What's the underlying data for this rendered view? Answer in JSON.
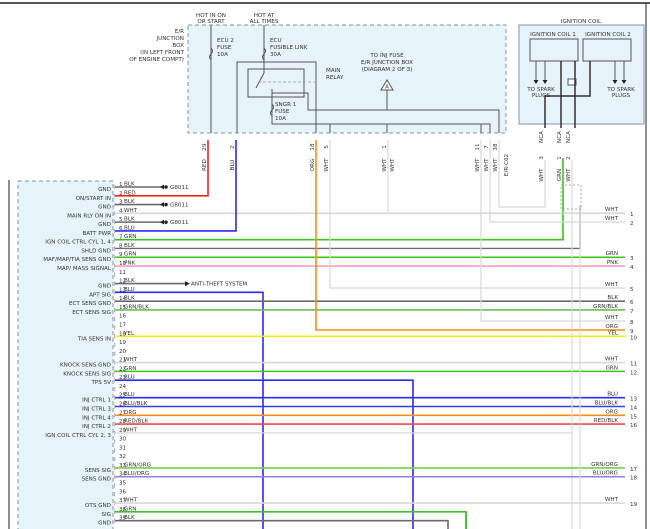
{
  "wire_colors": {
    "RED": "#ff2020",
    "BLU": "#2a2aff",
    "GRN": "#3cc21c",
    "BLK": "#6a6a6a",
    "WHT": "#d8d8d8",
    "PNK": "#f5a0b4",
    "YEL": "#f2f000",
    "ORG": "#ff8a10",
    "GRN/BLK": "#6cc050",
    "BLU/BLK": "#3a3ae8",
    "RED/BLK": "#f04848",
    "GRN/ORG": "#80c848",
    "BLU/ORG": "#9080e4"
  },
  "panel_fill": "#e6f3fa",
  "junction_box": {
    "label": [
      "E/R",
      "JUNCTION",
      "BOX",
      "(IN LEFT FRONT",
      "OF ENGINE COMPT)"
    ],
    "hot_in_on_start": [
      "HOT IN ON",
      "OR START"
    ],
    "hot_at_all_times": [
      "HOT AT",
      "ALL TIMES"
    ],
    "ecu2_fuse": [
      "ECU 2",
      "FUSE",
      "10A"
    ],
    "ecu_fusible_link": [
      "ECU",
      "FUSIBLE LINK",
      "30A"
    ],
    "main_relay": [
      "MAIN",
      "RELAY"
    ],
    "sngr1_fuse": [
      "SNGR 1",
      "FUSE",
      "10A"
    ],
    "to_inj_fuse": [
      "TO INJ FUSE",
      "E/R JUNCTION BOX",
      "(DIAGRAM 2 OF 3)"
    ],
    "ref_marker": "A",
    "connector_id": "E/R-C62",
    "pins": [
      {
        "pin": "29",
        "color": "RED"
      },
      {
        "pin": "2",
        "color": "BLU"
      },
      {
        "pin": "18",
        "color": "ORG"
      },
      {
        "pin": "5",
        "color": "WHT"
      },
      {
        "pin": "1",
        "color": "WHT",
        "color2": "WHT"
      },
      {
        "pin": "11",
        "color": "WHT"
      },
      {
        "pin": "7",
        "color": "WHT"
      },
      {
        "pin": "38",
        "color": "WHT"
      }
    ]
  },
  "ignition_coil": {
    "title": "IGNITION COIL",
    "coil1": "IGNITION COIL 1",
    "coil2": "IGNITION COIL 2",
    "to_spark_plugs": [
      "TO SPARK",
      "PLUGS"
    ],
    "connector_id": "NCA",
    "pins": [
      {
        "pin": "3",
        "color": "WHT"
      },
      {
        "pin": "1",
        "color": "GRN"
      },
      {
        "pin": "2",
        "color": "WHT"
      }
    ]
  },
  "ground_label": "G8011",
  "anti_theft_label": "ANTI-THEFT SYSTEM",
  "ecm_pins": [
    {
      "pin": "1",
      "label": "GND",
      "color": "BLK"
    },
    {
      "pin": "2",
      "label": "ON/START IN",
      "color": "RED"
    },
    {
      "pin": "3",
      "label": "GND",
      "color": "BLK"
    },
    {
      "pin": "4",
      "label": "MAIN RLY ON IN",
      "color": "WHT"
    },
    {
      "pin": "5",
      "label": "GND",
      "color": "BLK"
    },
    {
      "pin": "6",
      "label": "BATT PWR",
      "color": "BLU"
    },
    {
      "pin": "7",
      "label": "IGN COIL CTRL CYL 1, 4",
      "color": "GRN"
    },
    {
      "pin": "8",
      "label": "SHLD GND",
      "color": "BLK"
    },
    {
      "pin": "9",
      "label": "MAF/MAP/TIA SENS GND",
      "color": "GRN"
    },
    {
      "pin": "10",
      "label": "MAP/ MASS SIGNAL",
      "color": "PNK"
    },
    {
      "pin": "11",
      "label": "",
      "color": ""
    },
    {
      "pin": "12",
      "label": "GND",
      "color": "BLK"
    },
    {
      "pin": "13",
      "label": "APT SIG",
      "color": "BLU"
    },
    {
      "pin": "14",
      "label": "ECT SENS GND",
      "color": "BLK"
    },
    {
      "pin": "15",
      "label": "ECT SENS SIG",
      "color": "GRN/BLK"
    },
    {
      "pin": "16",
      "label": "",
      "color": ""
    },
    {
      "pin": "17",
      "label": "",
      "color": ""
    },
    {
      "pin": "18",
      "label": "TIA SENS IN",
      "color": "YEL"
    },
    {
      "pin": "19",
      "label": "",
      "color": ""
    },
    {
      "pin": "20",
      "label": "",
      "color": ""
    },
    {
      "pin": "21",
      "label": "KNOCK SENS GND",
      "color": "WHT"
    },
    {
      "pin": "22",
      "label": "KNOCK SENS SIG",
      "color": "GRN"
    },
    {
      "pin": "23",
      "label": "TPS 5V",
      "color": "BLU"
    },
    {
      "pin": "24",
      "label": "",
      "color": ""
    },
    {
      "pin": "25",
      "label": "INJ CTRL 1",
      "color": "BLU"
    },
    {
      "pin": "26",
      "label": "INJ CTRL 3",
      "color": "BLU/BLK"
    },
    {
      "pin": "27",
      "label": "INJ CTRL 4",
      "color": "ORG"
    },
    {
      "pin": "28",
      "label": "INJ CTRL 2",
      "color": "RED/BLK"
    },
    {
      "pin": "29",
      "label": "IGN COIL CTRL CYL 2, 3",
      "color": "WHT"
    },
    {
      "pin": "30",
      "label": "",
      "color": ""
    },
    {
      "pin": "31",
      "label": "",
      "color": ""
    },
    {
      "pin": "32",
      "label": "",
      "color": ""
    },
    {
      "pin": "33",
      "label": "SENS SIG",
      "color": "GRN/ORG"
    },
    {
      "pin": "34",
      "label": "SENS GND",
      "color": "BLU/ORG"
    },
    {
      "pin": "35",
      "label": "",
      "color": ""
    },
    {
      "pin": "36",
      "label": "",
      "color": ""
    },
    {
      "pin": "37",
      "label": "OTS GND",
      "color": "WHT"
    },
    {
      "pin": "38",
      "label": "SIG",
      "color": "GRN"
    },
    {
      "pin": "39",
      "label": "GND",
      "color": "BLK"
    }
  ],
  "right_refs": [
    {
      "pin": "1",
      "color": "WHT"
    },
    {
      "pin": "2",
      "color": "WHT"
    },
    {
      "pin": "3",
      "color": "GRN"
    },
    {
      "pin": "4",
      "color": "PNK"
    },
    {
      "pin": "5",
      "color": "WHT"
    },
    {
      "pin": "6",
      "color": "BLK"
    },
    {
      "pin": "7",
      "color": "GRN/BLK"
    },
    {
      "pin": "8",
      "color": "WHT"
    },
    {
      "pin": "9",
      "color": "ORG"
    },
    {
      "pin": "10",
      "color": "YEL"
    },
    {
      "pin": "11",
      "color": "WHT"
    },
    {
      "pin": "12",
      "color": "GRN"
    },
    {
      "pin": "13",
      "color": "BLU"
    },
    {
      "pin": "14",
      "color": "BLU/BLK"
    },
    {
      "pin": "15",
      "color": "ORG"
    },
    {
      "pin": "16",
      "color": "RED/BLK"
    },
    {
      "pin": "17",
      "color": "GRN/ORG"
    },
    {
      "pin": "18",
      "color": "BLU/ORG"
    },
    {
      "pin": "19",
      "color": "WHT"
    }
  ]
}
